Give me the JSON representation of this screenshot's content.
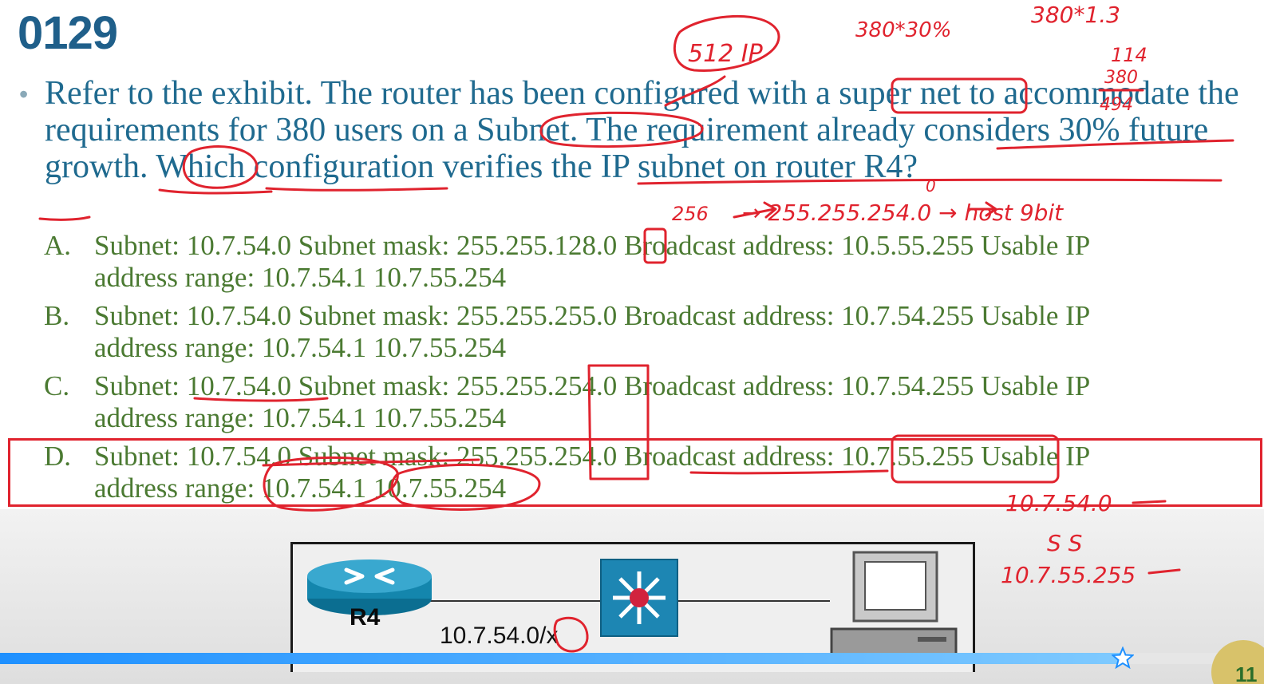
{
  "slide": {
    "number": "0129"
  },
  "question": {
    "text": "Refer to the exhibit. The router has been configured with a super net to accommodate the requirements for 380 users on a Subnet. The requirement already considers 30% future growth. Which configuration verifies the IP subnet on router R4?"
  },
  "options": [
    {
      "letter": "A.",
      "line1": "Subnet: 10.7.54.0 Subnet mask: 255.255.128.0 Broadcast address: 10.5.55.255 Usable IP",
      "line2": "address range: 10.7.54.1 10.7.55.254"
    },
    {
      "letter": "B.",
      "line1": "Subnet: 10.7.54.0 Subnet mask: 255.255.255.0 Broadcast address: 10.7.54.255 Usable IP",
      "line2": "address range: 10.7.54.1 10.7.55.254"
    },
    {
      "letter": "C.",
      "line1": "Subnet: 10.7.54.0 Subnet mask: 255.255.254.0 Broadcast address: 10.7.54.255 Usable IP",
      "line2": "address range: 10.7.54.1 10.7.55.254"
    },
    {
      "letter": "D.",
      "line1": "Subnet: 10.7.54.0 Subnet mask: 255.255.254.0 Broadcast address: 10.7.55.255 Usable IP",
      "line2": "address range: 10.7.54.1 10.7.55.254"
    }
  ],
  "exhibit": {
    "router_label": "R4",
    "network_label": "10.7.54.0/x"
  },
  "annotations": {
    "ip512": "512 IP",
    "calc1": "380*30%",
    "calc2": "380*1.3",
    "sum_a": "114",
    "sum_b": "380",
    "sum_c": "494",
    "mask_note": "→ 255.255.254.0 → host 9bit",
    "scratch": "256",
    "hand_subnet": "10.7.54.0",
    "ss": "S  S",
    "hand_bcast": "10.7.55.255",
    "zero_mark": "0"
  },
  "video": {
    "progress": 0.89
  },
  "colors": {
    "title": "#1f5f8a",
    "question": "#1f6a8f",
    "options": "#4b7a32",
    "ink": "#e0232e",
    "progress": "#1e90ff"
  }
}
